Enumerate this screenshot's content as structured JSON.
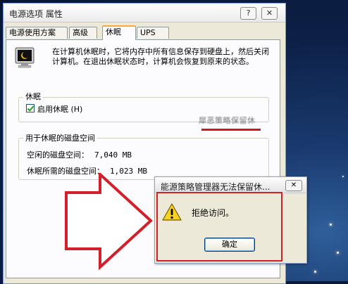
{
  "window": {
    "title": "电源选项 属性",
    "help_button": "?",
    "close_button": "✕"
  },
  "tabs": [
    {
      "label": "电源使用方案",
      "active": false
    },
    {
      "label": "高级",
      "active": false
    },
    {
      "label": "休眠",
      "active": true
    },
    {
      "label": "UPS",
      "active": false
    }
  ],
  "hibernate_tab": {
    "description": "在计算机休眠时，它将内存中所有信息保存到硬盘上，然后关闭计算机。在退出休眠状态时，计算机会恢复到原来的状态。",
    "group_label": "休眠",
    "checkbox_label": "启用休眠 (H)",
    "checkbox_checked": true,
    "obscured_text": "犀恶策略保留休",
    "disk_group_label": "用于休眠的磁盘空间",
    "free_space_label": "空闲的磁盘空间：",
    "free_space_value": "7,040 MB",
    "required_space_label": "休眠所需的磁盘空间：",
    "required_space_value": "1,023 MB"
  },
  "error_dialog": {
    "title": "能源策略管理器无法保留休...",
    "close_button": "✕",
    "message": "拒绝访问。",
    "ok_button": "确定"
  },
  "colors": {
    "highlight_red": "#d21f2a",
    "dialog_bg": "#ece9d8",
    "active_tab_accent": "#f5aa37"
  }
}
